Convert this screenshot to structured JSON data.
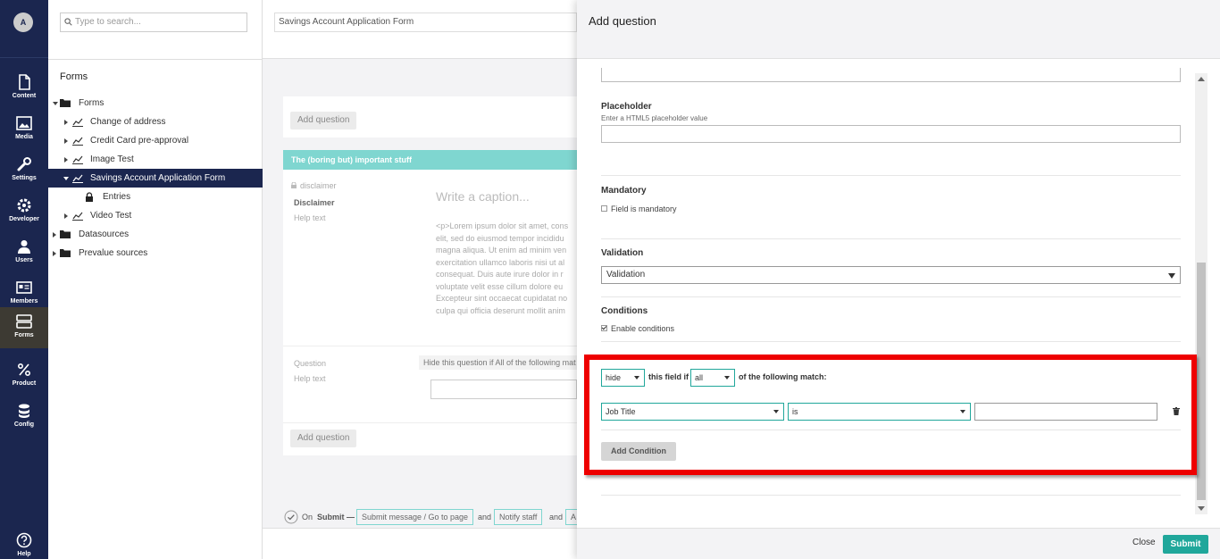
{
  "nav": {
    "avatar": "A",
    "items": [
      {
        "label": "Content",
        "icon": "document-icon"
      },
      {
        "label": "Media",
        "icon": "image-icon"
      },
      {
        "label": "Settings",
        "icon": "wrench-icon"
      },
      {
        "label": "Developer",
        "icon": "gear-icon"
      },
      {
        "label": "Users",
        "icon": "user-icon"
      },
      {
        "label": "Members",
        "icon": "id-card-icon"
      },
      {
        "label": "Forms",
        "icon": "forms-icon"
      },
      {
        "label": "Product",
        "icon": "percent-icon"
      },
      {
        "label": "Config",
        "icon": "database-icon"
      }
    ],
    "help": "Help"
  },
  "tree": {
    "search_placeholder": "Type to search...",
    "title": "Forms",
    "nodes": [
      {
        "label": "Forms"
      },
      {
        "label": "Change of address"
      },
      {
        "label": "Credit Card pre-approval"
      },
      {
        "label": "Image Test"
      },
      {
        "label": "Savings Account Application Form"
      },
      {
        "label": "Entries"
      },
      {
        "label": "Video Test"
      },
      {
        "label": "Datasources"
      },
      {
        "label": "Prevalue sources"
      }
    ]
  },
  "editor": {
    "form_name": "Savings Account Application Form",
    "add_question": "Add question",
    "section_title": "The (boring but) important stuff",
    "disclaimer_alias": "disclaimer",
    "disclaimer_label": "Disclaimer",
    "help_text": "Help text",
    "caption_placeholder": "Write a caption...",
    "lorem_lines": [
      "<p>Lorem ipsum dolor sit amet, cons",
      "elit, sed do eiusmod tempor incididu",
      "magna aliqua. Ut enim ad minim ven",
      "exercitation ullamco laboris nisi ut al",
      "consequat. Duis aute irure dolor in r",
      "voluptate velit esse cillum dolore eu",
      "Excepteur sint occaecat cupidatat no",
      "culpa qui officia deserunt mollit anim"
    ],
    "question_label": "Question",
    "question_help": "Help text",
    "hide_hint": "Hide this question if All of the following mat",
    "add_question_2": "Add question",
    "submit_bar": {
      "on": "On",
      "submit": "Submit —",
      "chip1": "Submit message / Go to page",
      "and1": "and",
      "chip2": "Notify staff",
      "and2": "and",
      "chip3": "A"
    }
  },
  "dialog": {
    "title": "Add question",
    "placeholder_label": "Placeholder",
    "placeholder_desc": "Enter a HTML5 placeholder value",
    "mandatory_label": "Mandatory",
    "mandatory_check": "Field is mandatory",
    "validation_label": "Validation",
    "validation_value": "Validation",
    "conditions_label": "Conditions",
    "conditions_check": "Enable conditions",
    "condition": {
      "action": "hide",
      "this_field_if": "this field if",
      "logic": "all",
      "following_match": "of the following match:",
      "field": "Job Title",
      "operator": "is",
      "value": ""
    },
    "add_condition": "Add Condition",
    "close": "Close",
    "submit": "Submit"
  },
  "colors": {
    "nav_bg": "#1b264f",
    "accent": "#20a79b",
    "section_head": "#7fd6d0",
    "highlight": "#ee0000"
  }
}
